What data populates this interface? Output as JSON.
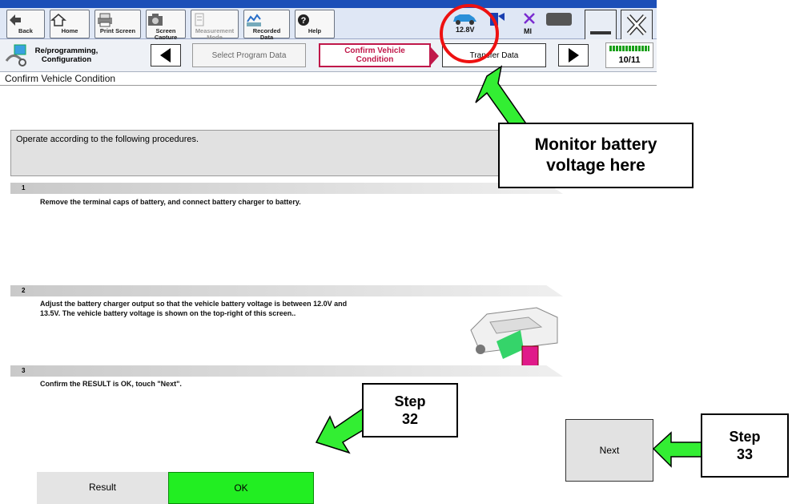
{
  "toolbar": {
    "back": "Back",
    "home": "Home",
    "print_screen": "Print Screen",
    "screen_capture": "Screen Capture",
    "measurement_mode": "Measurement Mode",
    "recorded_data": "Recorded Data",
    "help": "Help",
    "battery_voltage": "12.8V",
    "mi_label": "MI"
  },
  "nav": {
    "section": "Re/programming, Configuration",
    "crumb_prev": "Select Program Data",
    "crumb_current": "Confirm Vehicle Condition",
    "crumb_next": "Transfer Data",
    "step_counter": "10/11"
  },
  "page": {
    "title": "Confirm Vehicle Condition",
    "instruction": "Operate according to the following procedures."
  },
  "steps": [
    {
      "number": "1",
      "text": "Remove the terminal caps of battery, and connect battery charger to battery."
    },
    {
      "number": "2",
      "text_line1": "Adjust the battery charger output so that the vehicle battery voltage is between 12.0V and",
      "text_line2": "13.5V. The vehicle battery voltage is shown on the top-right of this screen.."
    },
    {
      "number": "3",
      "text": "Confirm the RESULT is OK, touch \"Next\"."
    }
  ],
  "result": {
    "label": "Result",
    "value": "OK"
  },
  "next_label": "Next",
  "callouts": {
    "monitor_line1": "Monitor battery",
    "monitor_line2": "voltage here",
    "step32_line1": "Step",
    "step32_line2": "32",
    "step33_line1": "Step",
    "step33_line2": "33"
  },
  "colors": {
    "ok_green": "#22ee22",
    "annotation_arrow": "#33ee33",
    "highlight_circle": "#ee1111",
    "current_step_border": "#c0184a"
  }
}
